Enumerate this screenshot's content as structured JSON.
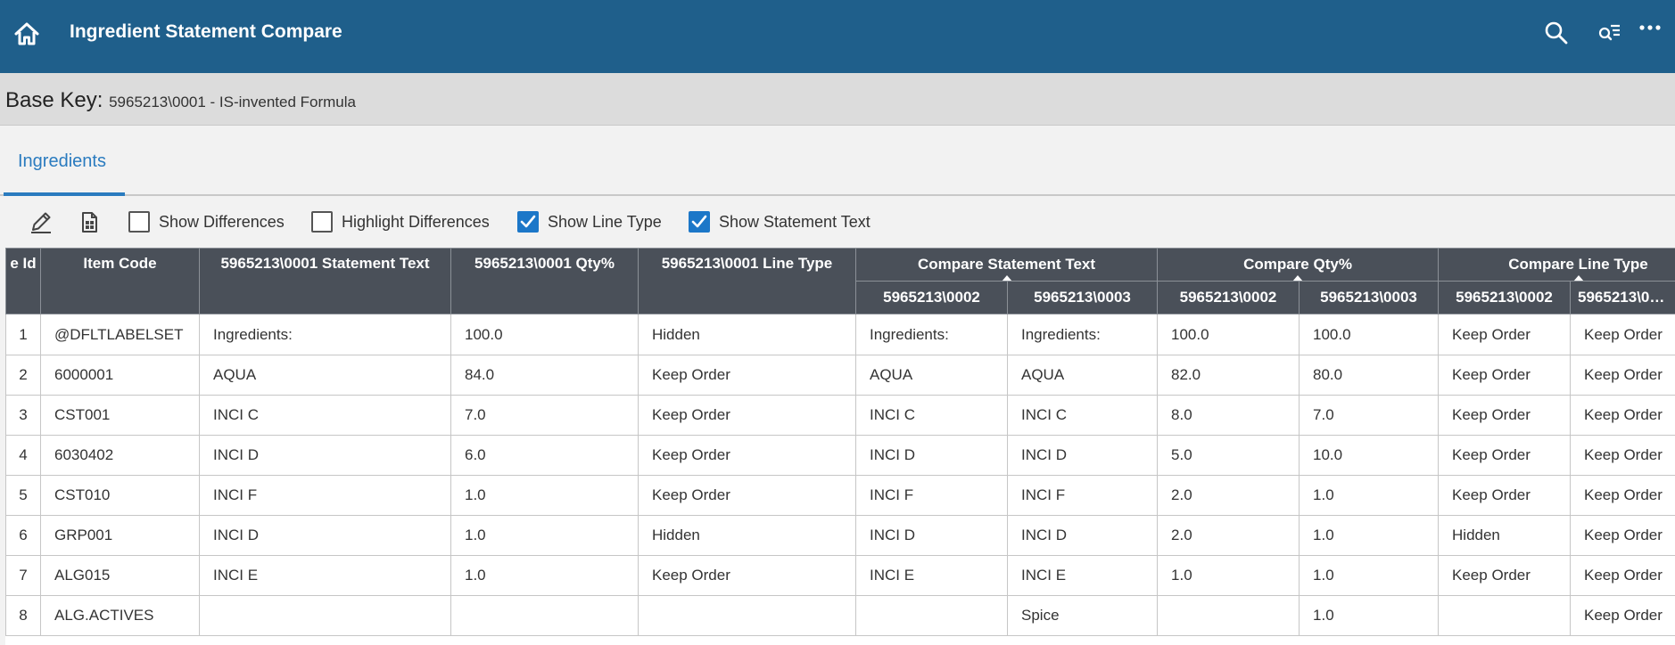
{
  "header": {
    "title": "Ingredient Statement Compare"
  },
  "base_key": {
    "label": "Base Key:",
    "value": "5965213\\0001 - IS-invented Formula"
  },
  "tabs": [
    {
      "label": "Ingredients",
      "active": true
    }
  ],
  "toolbar": {
    "checkboxes": [
      {
        "label": "Show Differences",
        "checked": false
      },
      {
        "label": "Highlight Differences",
        "checked": false
      },
      {
        "label": "Show Line Type",
        "checked": true
      },
      {
        "label": "Show Statement Text",
        "checked": true
      }
    ]
  },
  "grid": {
    "columns": {
      "id": "e Id",
      "item_code": "Item Code",
      "base_statement": "5965213\\0001 Statement Text",
      "base_qty": "5965213\\0001 Qty%",
      "base_line_type": "5965213\\0001 Line Type"
    },
    "groups": {
      "statement": "Compare Statement Text",
      "qty": "Compare Qty%",
      "line_type": "Compare Line Type"
    },
    "subcolumns": {
      "statement_a": "5965213\\0002",
      "statement_b": "5965213\\0003",
      "qty_a": "5965213\\0002",
      "qty_b": "5965213\\0003",
      "line_type_a": "5965213\\0002",
      "line_type_b": "5965213\\0…"
    },
    "rows": [
      [
        "1",
        "@DFLTLABELSET",
        "Ingredients:",
        "100.0",
        "Hidden",
        "Ingredients:",
        "Ingredients:",
        "100.0",
        "100.0",
        "Keep Order",
        "Keep Order"
      ],
      [
        "2",
        "6000001",
        "AQUA",
        "84.0",
        "Keep Order",
        "AQUA",
        "AQUA",
        "82.0",
        "80.0",
        "Keep Order",
        "Keep Order"
      ],
      [
        "3",
        "CST001",
        "INCI C",
        "7.0",
        "Keep Order",
        "INCI C",
        "INCI C",
        "8.0",
        "7.0",
        "Keep Order",
        "Keep Order"
      ],
      [
        "4",
        "6030402",
        "INCI D",
        "6.0",
        "Keep Order",
        "INCI D",
        "INCI D",
        "5.0",
        "10.0",
        "Keep Order",
        "Keep Order"
      ],
      [
        "5",
        "CST010",
        "INCI F",
        "1.0",
        "Keep Order",
        "INCI F",
        "INCI F",
        "2.0",
        "1.0",
        "Keep Order",
        "Keep Order"
      ],
      [
        "6",
        "GRP001",
        "INCI D",
        "1.0",
        "Hidden",
        "INCI D",
        "INCI D",
        "2.0",
        "1.0",
        "Hidden",
        "Keep Order"
      ],
      [
        "7",
        "ALG015",
        "INCI E",
        "1.0",
        "Keep Order",
        "INCI E",
        "INCI E",
        "1.0",
        "1.0",
        "Keep Order",
        "Keep Order"
      ],
      [
        "8",
        "ALG.ACTIVES",
        "",
        "",
        "",
        "",
        "Spice",
        "",
        "1.0",
        "",
        "Keep Order"
      ]
    ]
  },
  "colors": {
    "header_bg": "#1f5f8b",
    "grid_header_bg": "#4a5059",
    "accent": "#2a7bbf",
    "checkbox_checked": "#1c77c8"
  },
  "icons": {
    "home": "home-icon",
    "search": "search-icon",
    "filter_search": "filter-search-icon",
    "more": "more-options-icon",
    "edit": "pencil-icon",
    "export": "document-export-icon",
    "check": "check-icon"
  }
}
